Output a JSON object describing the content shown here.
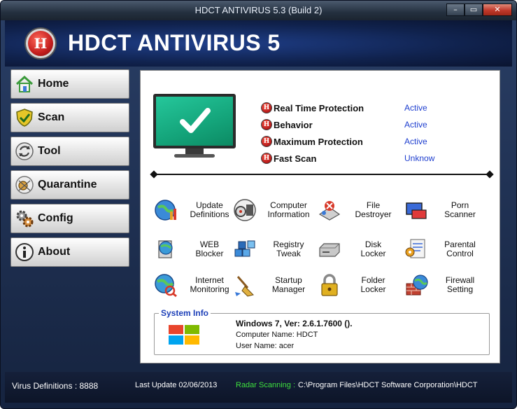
{
  "window": {
    "title": "HDCT ANTIVIRUS 5.3 (Build 2)",
    "controls": {
      "minimize": "–",
      "maximize": "▭",
      "close": "✕"
    }
  },
  "header": {
    "logo_letter": "H",
    "app_name": "HDCT ANTIVIRUS 5"
  },
  "sidebar": {
    "items": [
      {
        "label": "Home",
        "icon": "home-icon"
      },
      {
        "label": "Scan",
        "icon": "shield-check-icon"
      },
      {
        "label": "Tool",
        "icon": "tool-arrows-icon"
      },
      {
        "label": "Quarantine",
        "icon": "quarantine-icon"
      },
      {
        "label": "Config",
        "icon": "gears-icon"
      },
      {
        "label": "About",
        "icon": "info-icon"
      }
    ]
  },
  "protection": {
    "badge": "H",
    "items": [
      {
        "label": "Real Time Protection",
        "status": "Active"
      },
      {
        "label": "Behavior",
        "status": "Active"
      },
      {
        "label": "Maximum Protection",
        "status": "Active"
      },
      {
        "label": "Fast Scan",
        "status": "Unknow"
      }
    ]
  },
  "tools": [
    {
      "label_1": "Update",
      "label_2": "Definitions",
      "icon": "globe-update-icon"
    },
    {
      "label_1": "Computer",
      "label_2": "Information",
      "icon": "computer-info-icon"
    },
    {
      "label_1": "File",
      "label_2": "Destroyer",
      "icon": "file-destroyer-icon"
    },
    {
      "label_1": "Porn",
      "label_2": "Scanner",
      "icon": "porn-scanner-icon"
    },
    {
      "label_1": "WEB",
      "label_2": "Blocker",
      "icon": "web-blocker-icon"
    },
    {
      "label_1": "Registry",
      "label_2": "Tweak",
      "icon": "registry-cubes-icon"
    },
    {
      "label_1": "Disk",
      "label_2": "Locker",
      "icon": "disk-drive-icon"
    },
    {
      "label_1": "Parental",
      "label_2": "Control",
      "icon": "parental-control-icon"
    },
    {
      "label_1": "Internet",
      "label_2": "Monitoring",
      "icon": "internet-monitor-icon"
    },
    {
      "label_1": "Startup",
      "label_2": "Manager",
      "icon": "startup-broom-icon"
    },
    {
      "label_1": "Folder",
      "label_2": "Locker",
      "icon": "padlock-icon"
    },
    {
      "label_1": "Firewall",
      "label_2": "Setting",
      "icon": "firewall-globe-icon"
    }
  ],
  "system_info": {
    "legend": "System Info",
    "os": "Windows 7, Ver: 2.6.1.7600  ().",
    "computer_name": "Computer Name: HDCT",
    "user_name": "User Name: acer"
  },
  "statusbar": {
    "virus_definitions": "Virus Definitions : 8888",
    "last_update": "Last Update 02/06/2013",
    "radar_label": "Radar Scanning :",
    "radar_path": "C:\\Program Files\\HDCT Software Corporation\\HDCT"
  },
  "colors": {
    "status_active": "#1f3fcf",
    "radar_label": "#3ee03e",
    "legend": "#1c3fb8",
    "monitor_screen": "#14a47a"
  }
}
